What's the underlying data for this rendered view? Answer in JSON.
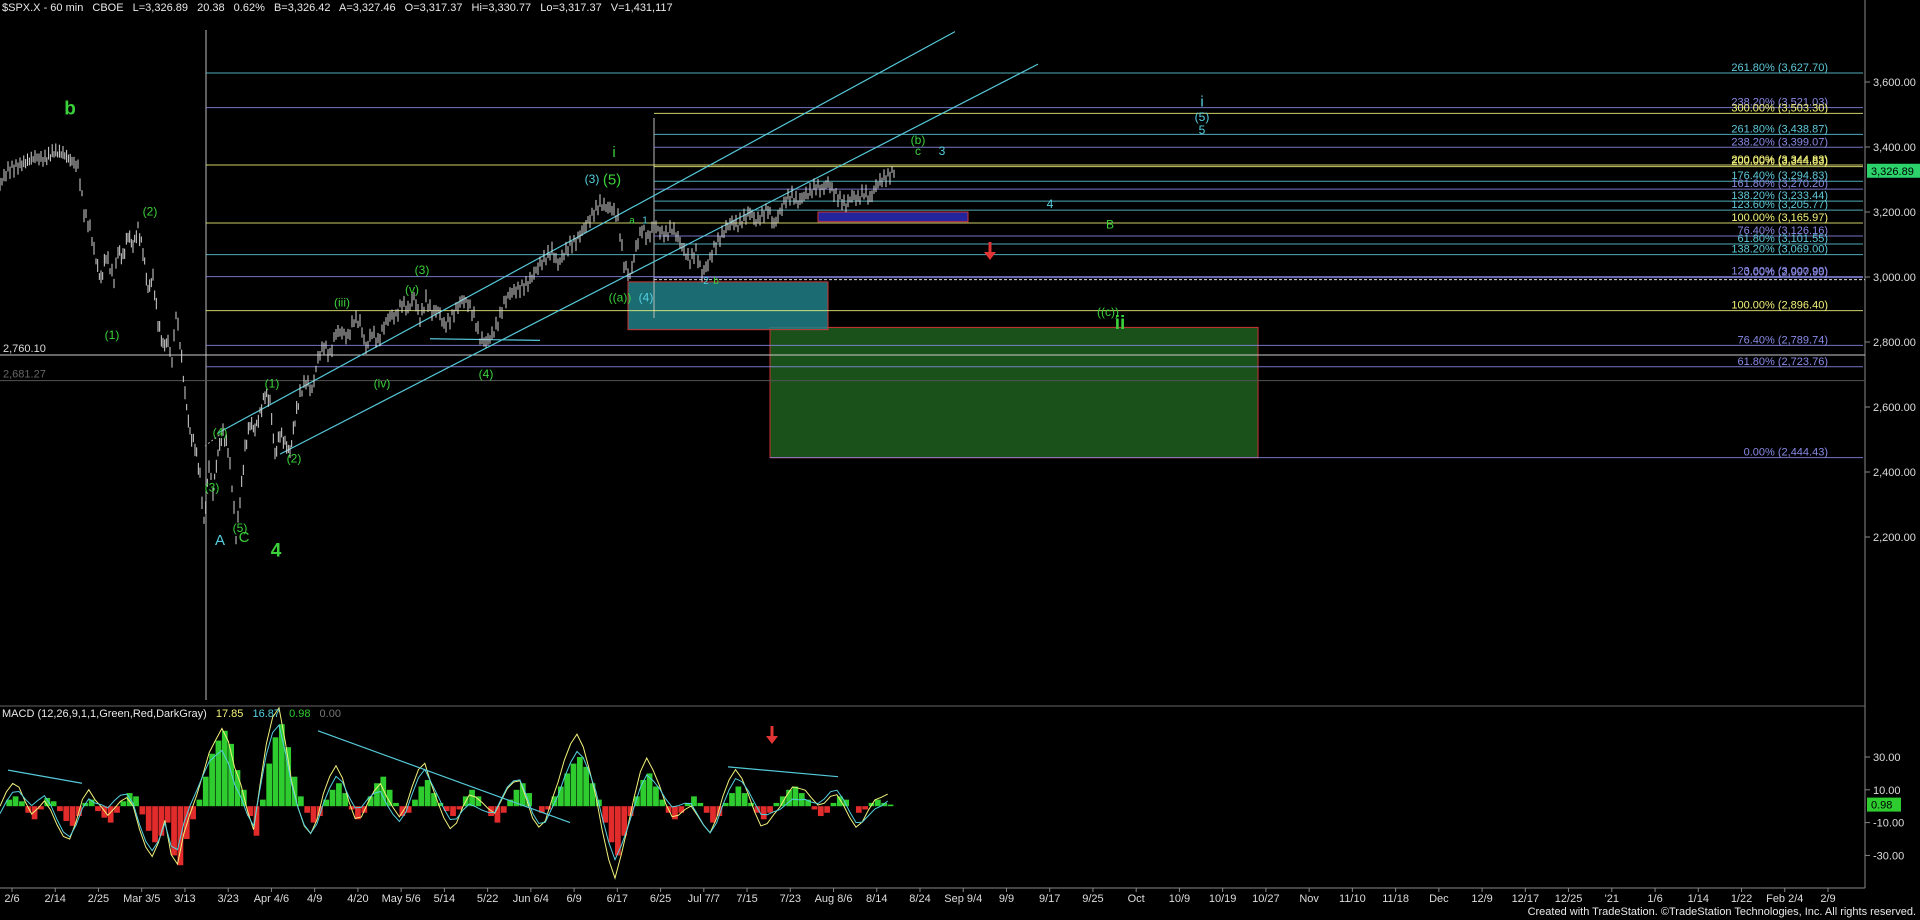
{
  "header": {
    "symbol": "$SPX.X - 60 min",
    "exchange": "CBOE",
    "last": "L=3,326.89",
    "change": "20.38",
    "change_pct": "0.62%",
    "bid": "B=3,326.42",
    "ask": "A=3,327.46",
    "open": "O=3,317.37",
    "high": "Hi=3,330.77",
    "low": "Lo=3,317.37",
    "volume": "V=1,431,117"
  },
  "macd_header": {
    "label": "MACD (12,26,9,1,1,Green,Red,DarkGray)",
    "v1": "17.85",
    "v2": "16.87",
    "v3": "0.98",
    "v4": "0.00"
  },
  "footer": "Created with TradeStation. ©TradeStation Technologies, Inc. All rights reserved.",
  "colors": {
    "bg": "#000000",
    "wave_green": "#3bd13b",
    "wave_cyan": "#55d0e0",
    "fib_yellow": "#f2f27a",
    "fib_blue": "#8a8ae6",
    "fib_cyan": "#5fc9d9",
    "channel": "#55c8d8",
    "target_green": "#1f5f1f",
    "target_teal": "#1f7f86",
    "target_blue": "#2a2ab8",
    "down_arrow": "#e23434",
    "macd_pos": "#2ecc2e",
    "macd_neg": "#e22c2c"
  },
  "chart_data": {
    "type": "candlestick",
    "instrument": "$SPX.X",
    "interval": "60 min",
    "ylim": [
      2000,
      3700
    ],
    "y_ticks": [
      "3,600.00",
      "3,400.00",
      "3,200.00",
      "3,000.00",
      "2,800.00",
      "2,600.00",
      "2,400.00",
      "2,200.00"
    ],
    "last_price": "3,326.89",
    "x_ticks": [
      "2/6",
      "2/14",
      "2/25",
      "Mar 3/5",
      "3/13",
      "3/23",
      "Apr 4/6",
      "4/9",
      "4/20",
      "May 5/6",
      "5/14",
      "5/22",
      "Jun 6/4",
      "6/9",
      "6/17",
      "6/25",
      "Jul 7/7",
      "7/15",
      "7/23",
      "Aug 8/6",
      "8/14",
      "8/24",
      "Sep 9/4",
      "9/9",
      "9/17",
      "9/25",
      "Oct",
      "10/9",
      "10/19",
      "10/27",
      "Nov",
      "11/10",
      "11/18",
      "Dec",
      "12/9",
      "12/17",
      "12/25",
      "'21",
      "1/6",
      "1/14",
      "1/22",
      "Feb 2/4",
      "2/9"
    ],
    "price_path": [
      [
        0,
        3285
      ],
      [
        8,
        3330
      ],
      [
        20,
        3345
      ],
      [
        35,
        3368
      ],
      [
        45,
        3362
      ],
      [
        54,
        3385
      ],
      [
        63,
        3380
      ],
      [
        72,
        3355
      ],
      [
        78,
        3340
      ],
      [
        84,
        3200
      ],
      [
        90,
        3150
      ],
      [
        96,
        3050
      ],
      [
        101,
        2990
      ],
      [
        106,
        3065
      ],
      [
        110,
        3030
      ],
      [
        114,
        2990
      ],
      [
        118,
        3080
      ],
      [
        123,
        3060
      ],
      [
        128,
        3130
      ],
      [
        133,
        3095
      ],
      [
        138,
        3150
      ],
      [
        143,
        3080
      ],
      [
        148,
        2960
      ],
      [
        153,
        3000
      ],
      [
        158,
        2860
      ],
      [
        163,
        2790
      ],
      [
        168,
        2800
      ],
      [
        172,
        2740
      ],
      [
        176,
        2890
      ],
      [
        180,
        2800
      ],
      [
        185,
        2640
      ],
      [
        190,
        2520
      ],
      [
        195,
        2480
      ],
      [
        200,
        2390
      ],
      [
        204,
        2240
      ],
      [
        209,
        2420
      ],
      [
        213,
        2340
      ],
      [
        218,
        2460
      ],
      [
        223,
        2520
      ],
      [
        228,
        2470
      ],
      [
        232,
        2360
      ],
      [
        236,
        2200
      ],
      [
        240,
        2310
      ],
      [
        245,
        2470
      ],
      [
        250,
        2550
      ],
      [
        255,
        2530
      ],
      [
        260,
        2580
      ],
      [
        265,
        2640
      ],
      [
        270,
        2620
      ],
      [
        275,
        2450
      ],
      [
        280,
        2520
      ],
      [
        285,
        2490
      ],
      [
        290,
        2460
      ],
      [
        295,
        2560
      ],
      [
        300,
        2640
      ],
      [
        306,
        2680
      ],
      [
        312,
        2650
      ],
      [
        318,
        2750
      ],
      [
        324,
        2790
      ],
      [
        330,
        2760
      ],
      [
        336,
        2830
      ],
      [
        342,
        2830
      ],
      [
        348,
        2815
      ],
      [
        354,
        2870
      ],
      [
        360,
        2860
      ],
      [
        366,
        2780
      ],
      [
        372,
        2830
      ],
      [
        378,
        2800
      ],
      [
        384,
        2850
      ],
      [
        390,
        2880
      ],
      [
        396,
        2880
      ],
      [
        402,
        2920
      ],
      [
        408,
        2900
      ],
      [
        414,
        2940
      ],
      [
        420,
        2870
      ],
      [
        426,
        2930
      ],
      [
        432,
        2890
      ],
      [
        438,
        2900
      ],
      [
        444,
        2850
      ],
      [
        450,
        2870
      ],
      [
        456,
        2900
      ],
      [
        462,
        2930
      ],
      [
        468,
        2920
      ],
      [
        474,
        2880
      ],
      [
        480,
        2810
      ],
      [
        486,
        2800
      ],
      [
        492,
        2820
      ],
      [
        498,
        2860
      ],
      [
        504,
        2920
      ],
      [
        510,
        2950
      ],
      [
        516,
        2960
      ],
      [
        522,
        2970
      ],
      [
        528,
        2980
      ],
      [
        534,
        3010
      ],
      [
        540,
        3040
      ],
      [
        546,
        3060
      ],
      [
        552,
        3080
      ],
      [
        558,
        3040
      ],
      [
        564,
        3070
      ],
      [
        570,
        3100
      ],
      [
        576,
        3110
      ],
      [
        582,
        3140
      ],
      [
        588,
        3170
      ],
      [
        594,
        3200
      ],
      [
        600,
        3225
      ],
      [
        606,
        3215
      ],
      [
        612,
        3210
      ],
      [
        618,
        3180
      ],
      [
        624,
        3040
      ],
      [
        630,
        3000
      ],
      [
        636,
        3090
      ],
      [
        642,
        3150
      ],
      [
        648,
        3120
      ],
      [
        654,
        3160
      ],
      [
        660,
        3140
      ],
      [
        666,
        3130
      ],
      [
        672,
        3150
      ],
      [
        678,
        3120
      ],
      [
        684,
        3080
      ],
      [
        690,
        3050
      ],
      [
        696,
        3080
      ],
      [
        702,
        3010
      ],
      [
        708,
        3040
      ],
      [
        714,
        3090
      ],
      [
        720,
        3120
      ],
      [
        726,
        3150
      ],
      [
        732,
        3170
      ],
      [
        738,
        3160
      ],
      [
        744,
        3180
      ],
      [
        750,
        3200
      ],
      [
        756,
        3170
      ],
      [
        762,
        3190
      ],
      [
        768,
        3210
      ],
      [
        774,
        3160
      ],
      [
        780,
        3200
      ],
      [
        786,
        3240
      ],
      [
        792,
        3250
      ],
      [
        798,
        3230
      ],
      [
        804,
        3250
      ],
      [
        810,
        3260
      ],
      [
        816,
        3280
      ],
      [
        822,
        3270
      ],
      [
        828,
        3290
      ],
      [
        834,
        3260
      ],
      [
        840,
        3240
      ],
      [
        846,
        3220
      ],
      [
        852,
        3250
      ],
      [
        858,
        3240
      ],
      [
        864,
        3260
      ],
      [
        870,
        3240
      ],
      [
        876,
        3280
      ],
      [
        882,
        3300
      ],
      [
        888,
        3310
      ],
      [
        894,
        3326
      ]
    ],
    "fib_levels": [
      {
        "label": "261.80% (3,627.70)",
        "price": 3627.7,
        "color": "cyan",
        "span": "long"
      },
      {
        "label": "238.20% (3,521.03)",
        "price": 3521.0,
        "color": "blue",
        "span": "long"
      },
      {
        "label": "300.00% (3,503.30)",
        "price": 3503.3,
        "color": "yellow",
        "span": "mid"
      },
      {
        "label": "261.80% (3,438.87)",
        "price": 3438.9,
        "color": "cyan",
        "span": "mid"
      },
      {
        "label": "238.20% (3,399.07)",
        "price": 3399.1,
        "color": "blue",
        "span": "mid"
      },
      {
        "label": "200.00% (3,344.83)",
        "price": 3344.8,
        "color": "yellow",
        "span": "long"
      },
      {
        "label": "200.00% (3,344.83)",
        "price": 3339.5,
        "color": "yellow",
        "span": "mid"
      },
      {
        "label": "176.40% (3,294.83)",
        "price": 3294.8,
        "color": "cyan",
        "span": "mid"
      },
      {
        "label": "161.80% (3,270.20)",
        "price": 3270.2,
        "color": "blue",
        "span": "mid"
      },
      {
        "label": "138.20% (3,233.44)",
        "price": 3233.4,
        "color": "cyan",
        "span": "mid"
      },
      {
        "label": "123.60% (3,205.77)",
        "price": 3205.8,
        "color": "cyan",
        "span": "mid"
      },
      {
        "label": "100.00% (3,165.97)",
        "price": 3166.0,
        "color": "yellow",
        "span": "long"
      },
      {
        "label": "76.40% (3,126.16)",
        "price": 3126.2,
        "color": "blue",
        "span": "mid"
      },
      {
        "label": "61.80% (3,101.55)",
        "price": 3101.5,
        "color": "cyan",
        "span": "mid"
      },
      {
        "label": "138.20% (3,069.00)",
        "price": 3069.0,
        "color": "cyan",
        "span": "long"
      },
      {
        "label": "123.60% (3,000.99)",
        "price": 3001.0,
        "color": "blue",
        "span": "long"
      },
      {
        "label": "0.00% (2,997.90)",
        "price": 2997.9,
        "color": "blue",
        "span": "mid"
      },
      {
        "label": "100.00% (2,896.40)",
        "price": 2896.4,
        "color": "yellow",
        "span": "long"
      },
      {
        "label": "76.40% (2,789.74)",
        "price": 2789.7,
        "color": "blue",
        "span": "long"
      },
      {
        "label": "61.80% (2,723.76)",
        "price": 2723.8,
        "color": "blue",
        "span": "long"
      },
      {
        "label": "0.00% (2,444.43)",
        "price": 2444.4,
        "color": "blue",
        "span": "box"
      }
    ],
    "horizontal_levels": [
      {
        "label": "2,760.10",
        "price": 2760.1
      },
      {
        "label": "2,681.27",
        "price": 2681.3
      }
    ],
    "wave_labels": [
      {
        "text": "b",
        "x": 70,
        "price": 3500,
        "color": "green",
        "size": "xl"
      },
      {
        "text": "(2)",
        "x": 150,
        "price": 3190,
        "color": "green",
        "size": "m"
      },
      {
        "text": "(1)",
        "x": 112,
        "price": 2810,
        "color": "green",
        "size": "m"
      },
      {
        "text": "(4)",
        "x": 220,
        "price": 2510,
        "color": "green",
        "size": "m"
      },
      {
        "text": "(3)",
        "x": 212,
        "price": 2340,
        "color": "green",
        "size": "m"
      },
      {
        "text": "(5)",
        "x": 240,
        "price": 2215,
        "color": "green",
        "size": "m"
      },
      {
        "text": "C",
        "x": 244,
        "price": 2185,
        "color": "green",
        "size": "l"
      },
      {
        "text": "A",
        "x": 220,
        "price": 2175,
        "color": "cyan",
        "size": "l"
      },
      {
        "text": "4",
        "x": 276,
        "price": 2140,
        "color": "green",
        "size": "xl"
      },
      {
        "text": "(1)",
        "x": 272,
        "price": 2660,
        "color": "green",
        "size": "m"
      },
      {
        "text": "(2)",
        "x": 294,
        "price": 2430,
        "color": "green",
        "size": "m"
      },
      {
        "text": "(iii)",
        "x": 342,
        "price": 2910,
        "color": "green",
        "size": "m"
      },
      {
        "text": "(iv)",
        "x": 382,
        "price": 2660,
        "color": "green",
        "size": "m"
      },
      {
        "text": "(v)",
        "x": 412,
        "price": 2950,
        "color": "green",
        "size": "m"
      },
      {
        "text": "(3)",
        "x": 422,
        "price": 3010,
        "color": "green",
        "size": "m"
      },
      {
        "text": "(4)",
        "x": 486,
        "price": 2690,
        "color": "green",
        "size": "m"
      },
      {
        "text": "i",
        "x": 614,
        "price": 3370,
        "color": "green",
        "size": "l"
      },
      {
        "text": "(3)",
        "x": 592,
        "price": 3290,
        "color": "cyan",
        "size": "m"
      },
      {
        "text": "(5)",
        "x": 612,
        "price": 3285,
        "color": "green",
        "size": "l"
      },
      {
        "text": "a",
        "x": 632,
        "price": 3165,
        "color": "green",
        "size": "s"
      },
      {
        "text": "1",
        "x": 645,
        "price": 3165,
        "color": "cyan",
        "size": "s"
      },
      {
        "text": "((a))",
        "x": 620,
        "price": 2925,
        "color": "green",
        "size": "m"
      },
      {
        "text": "(4)",
        "x": 646,
        "price": 2925,
        "color": "cyan",
        "size": "m"
      },
      {
        "text": "2",
        "x": 706,
        "price": 2978,
        "color": "cyan",
        "size": "s"
      },
      {
        "text": "b",
        "x": 716,
        "price": 2978,
        "color": "green",
        "size": "s"
      },
      {
        "text": "(b)",
        "x": 918,
        "price": 3410,
        "color": "green",
        "size": "m"
      },
      {
        "text": "c",
        "x": 918,
        "price": 3375,
        "color": "green",
        "size": "m"
      },
      {
        "text": "3",
        "x": 942,
        "price": 3375,
        "color": "cyan",
        "size": "m"
      },
      {
        "text": "4",
        "x": 1050,
        "price": 3213,
        "color": "cyan",
        "size": "m"
      },
      {
        "text": "B",
        "x": 1110,
        "price": 3150,
        "color": "green",
        "size": "m"
      },
      {
        "text": "((c))",
        "x": 1108,
        "price": 2880,
        "color": "green",
        "size": "m"
      },
      {
        "text": "ii",
        "x": 1120,
        "price": 2840,
        "color": "green",
        "size": "xl"
      },
      {
        "text": "i",
        "x": 1202,
        "price": 3525,
        "color": "cyan",
        "size": "l"
      },
      {
        "text": "(5)",
        "x": 1202,
        "price": 3480,
        "color": "cyan",
        "size": "m"
      },
      {
        "text": "5",
        "x": 1202,
        "price": 3440,
        "color": "cyan",
        "size": "m"
      }
    ],
    "zones": [
      {
        "name": "target-green",
        "x0": 770,
        "x1": 1258,
        "p0": 2845,
        "p1": 2444
      },
      {
        "name": "target-teal",
        "x0": 628,
        "x1": 828,
        "p0": 2985,
        "p1": 2838
      },
      {
        "name": "target-blue",
        "x0": 818,
        "x1": 968,
        "p0": 3200,
        "p1": 3170
      }
    ],
    "macd": {
      "ylim": [
        -45,
        55
      ],
      "y_ticks": [
        "30.00",
        "10.00",
        "-10.00",
        "-30.00"
      ],
      "macd_value": "0.98",
      "histogram": [
        0,
        4,
        6,
        3,
        -4,
        -8,
        -2,
        5,
        3,
        -3,
        -9,
        -12,
        -6,
        2,
        4,
        -3,
        -7,
        -10,
        -4,
        3,
        8,
        6,
        -5,
        -15,
        -22,
        -18,
        -10,
        -30,
        -36,
        -20,
        -8,
        4,
        18,
        32,
        40,
        46,
        38,
        22,
        10,
        -6,
        -18,
        4,
        26,
        42,
        50,
        36,
        18,
        6,
        -4,
        -10,
        -6,
        4,
        10,
        14,
        8,
        -2,
        -8,
        -4,
        6,
        14,
        18,
        10,
        2,
        -6,
        -4,
        4,
        12,
        16,
        8,
        2,
        -3,
        -6,
        -2,
        6,
        10,
        6,
        0,
        -6,
        -10,
        -4,
        4,
        10,
        14,
        8,
        0,
        -4,
        -2,
        6,
        12,
        20,
        26,
        30,
        24,
        14,
        4,
        -10,
        -22,
        -30,
        -18,
        -6,
        6,
        16,
        20,
        12,
        4,
        -4,
        -8,
        -4,
        2,
        6,
        2,
        -4,
        -10,
        -6,
        2,
        8,
        12,
        8,
        2,
        -4,
        -8,
        -4,
        2,
        6,
        10,
        12,
        8,
        4,
        -2,
        -6,
        -4,
        2,
        6,
        4,
        0,
        -4,
        -2,
        2,
        4,
        2,
        1
      ]
    }
  }
}
